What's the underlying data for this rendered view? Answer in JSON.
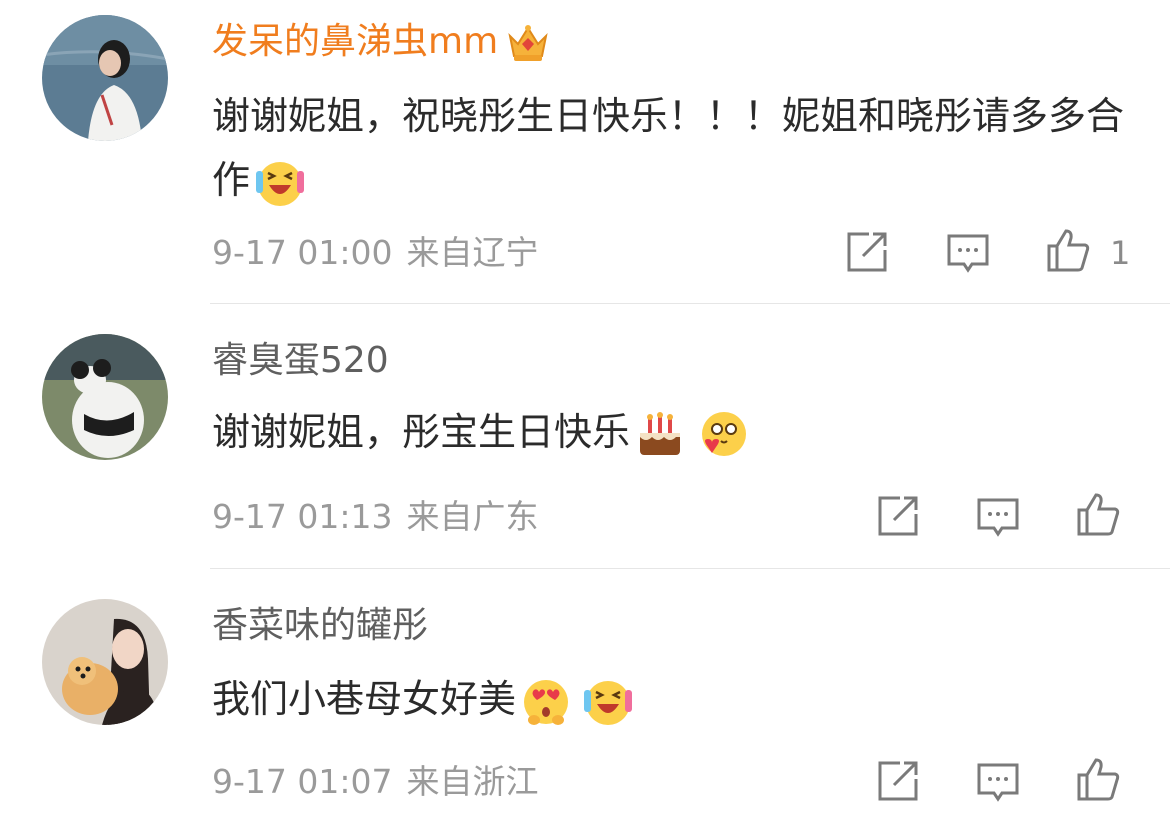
{
  "comments": [
    {
      "username": "发呆的鼻涕虫mm",
      "content": "谢谢妮姐，祝晓彤生日快乐！！！妮姐和晓彤请多多合作",
      "time": "9-17 01:00",
      "location": "来自辽宁",
      "likes": "1",
      "emojis": [
        "laugh-cry-emoji"
      ]
    },
    {
      "username": "睿臭蛋520",
      "content": "谢谢妮姐，彤宝生日快乐",
      "time": "9-17 01:13",
      "location": "来自广东",
      "likes": "",
      "emojis": [
        "cake-emoji",
        "love-emoji"
      ]
    },
    {
      "username": "香菜味的罐彤",
      "content": "我们小巷母女好美",
      "time": "9-17 01:07",
      "location": "来自浙江",
      "likes": "",
      "emojis": [
        "heart-eyes-emoji",
        "laugh-cry-emoji"
      ]
    }
  ],
  "colors": {
    "vip_name": "#f07d1e",
    "name": "#5f5f5f",
    "meta": "#9a9a9a"
  }
}
